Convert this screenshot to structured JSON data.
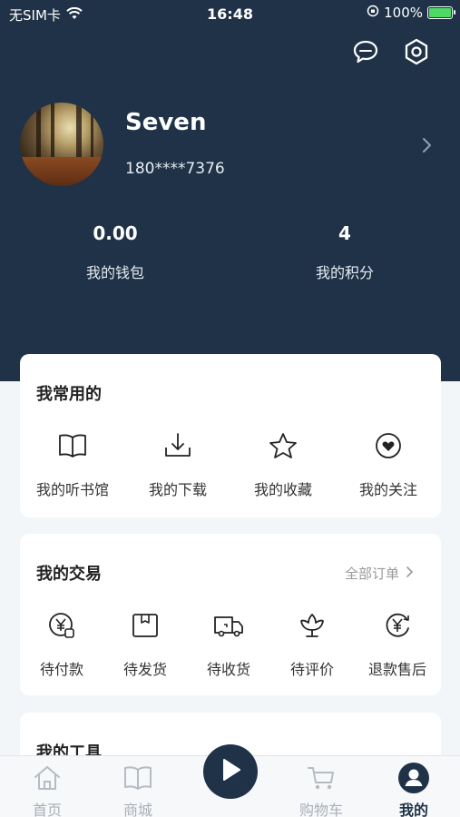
{
  "status_bar": {
    "carrier": "无SIM卡",
    "time": "16:48",
    "battery": "100%",
    "battery_level": 1.0
  },
  "header": {
    "chat_icon": "chat-bubble-icon",
    "settings_icon": "hexagon-settings-icon"
  },
  "profile": {
    "name": "Seven",
    "phone": "180****7376"
  },
  "stats": [
    {
      "value": "0.00",
      "label": "我的钱包"
    },
    {
      "value": "4",
      "label": "我的积分"
    }
  ],
  "frequent": {
    "title": "我常用的",
    "items": [
      {
        "label": "我的听书馆",
        "icon": "book-icon"
      },
      {
        "label": "我的下载",
        "icon": "download-icon"
      },
      {
        "label": "我的收藏",
        "icon": "star-icon"
      },
      {
        "label": "我的关注",
        "icon": "heart-icon"
      }
    ]
  },
  "trade": {
    "title": "我的交易",
    "link": "全部订单",
    "items": [
      {
        "label": "待付款",
        "icon": "yen-wallet-icon"
      },
      {
        "label": "待发货",
        "icon": "package-icon"
      },
      {
        "label": "待收货",
        "icon": "truck-icon"
      },
      {
        "label": "待评价",
        "icon": "flower-rating-icon"
      },
      {
        "label": "退款售后",
        "icon": "refund-yen-icon"
      }
    ]
  },
  "tools": {
    "title": "我的工具"
  },
  "tabbar": {
    "tabs": [
      {
        "label": "首页",
        "icon": "home-icon"
      },
      {
        "label": "商城",
        "icon": "book-icon"
      },
      {
        "label": "",
        "icon": "play-icon"
      },
      {
        "label": "购物车",
        "icon": "cart-icon"
      },
      {
        "label": "我的",
        "icon": "user-icon"
      }
    ],
    "active": "我的"
  },
  "colors": {
    "primary": "#1f3248",
    "background": "#f3f6f9",
    "inactive_tab": "#a9b0b8"
  }
}
